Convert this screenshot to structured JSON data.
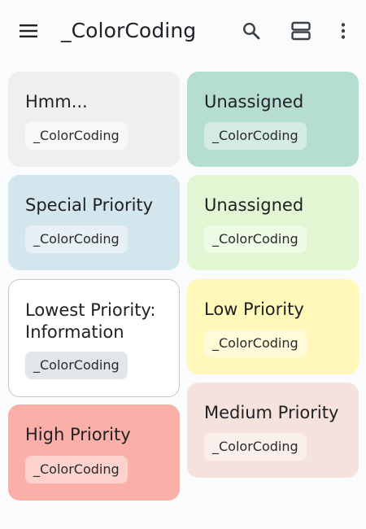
{
  "app": {
    "title": "_ColorCoding",
    "icons": {
      "menu": "menu-icon",
      "search": "search-icon",
      "view_toggle": "view-agenda-icon",
      "more": "more-vert-icon"
    }
  },
  "notes": [
    {
      "title": "Hmm...",
      "label": "_ColorCoding",
      "color": "#efefef"
    },
    {
      "title": "Unassigned",
      "label": "_ColorCoding",
      "color": "#b5ddd1"
    },
    {
      "title": "Special Priority",
      "label": "_ColorCoding",
      "color": "#d3e5ed"
    },
    {
      "title": "Unassigned",
      "label": "_ColorCoding",
      "color": "#e2f6d3"
    },
    {
      "title": "Lowest Priority:\nInformation",
      "label": "_ColorCoding",
      "color": "#ffffff",
      "border": "#c7c7c7"
    },
    {
      "title": "Low Priority",
      "label": "_ColorCoding",
      "color": "#fff8b8"
    },
    {
      "title": "High Priority",
      "label": "_ColorCoding",
      "color": "#faafa8"
    },
    {
      "title": "Medium Priority",
      "label": "_ColorCoding",
      "color": "#f6e2dd"
    }
  ],
  "colors": {
    "background": "#fafbfc",
    "icon": "#3c4043"
  }
}
